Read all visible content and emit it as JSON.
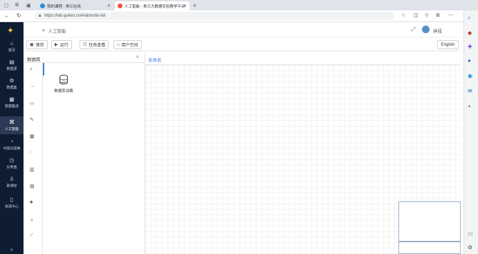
{
  "browser": {
    "tabs": [
      {
        "label": "我的课程 - 贵兰在线",
        "active": false,
        "favicon_color": "#2a8cd6"
      },
      {
        "label": "人工智能 - 贵兰大数据实验教学平台",
        "active": true,
        "favicon_color": "#e8553e"
      }
    ],
    "new_tab_icon": "plus-icon",
    "url": "https://lab.guilan.cn/#/aistudio-list"
  },
  "sidebar": {
    "items": [
      {
        "label": "首页",
        "icon": "home-icon",
        "glyph": "⌂",
        "active": false
      },
      {
        "label": "数据源",
        "icon": "file-icon",
        "glyph": "▤",
        "active": false
      },
      {
        "label": "数据集",
        "icon": "gear-icon",
        "glyph": "⚙",
        "active": false
      },
      {
        "label": "数据集成",
        "icon": "table-icon",
        "glyph": "▦",
        "active": false
      },
      {
        "label": "人工智能",
        "icon": "ai-icon",
        "glyph": "⌘",
        "active": true
      },
      {
        "label": "可视化探索",
        "icon": "pie-icon",
        "glyph": "◔",
        "active": false
      },
      {
        "label": "仪表盘",
        "icon": "dashboard-icon",
        "glyph": "◷",
        "active": false
      },
      {
        "label": "助课标",
        "icon": "person-icon",
        "glyph": "♙",
        "active": false
      },
      {
        "label": "资源中心",
        "icon": "book-icon",
        "glyph": "▯",
        "active": false
      }
    ],
    "collapse_glyph": "«"
  },
  "header": {
    "title": "人工智能",
    "user_name": "钟昆"
  },
  "toolbar": {
    "save_label": "保存",
    "run_label": "运行",
    "tasks_label": "任务查看",
    "userspace_label": "用户空间",
    "lang_label": "English"
  },
  "panel": {
    "title": "数据库",
    "db_item_label": "数据库加载",
    "strip_icons": [
      "search-icon",
      "arrow-icon",
      "window-icon",
      "wrench-icon",
      "grid-icon",
      "columns-icon",
      "bar-chart-icon",
      "image-icon",
      "tree-icon",
      "chart-icon",
      "line-chart-icon"
    ]
  },
  "canvas": {
    "tab_label": "未命名"
  },
  "colors": {
    "sidebar_bg": "#0f1d33",
    "accent": "#3d7fe0"
  }
}
